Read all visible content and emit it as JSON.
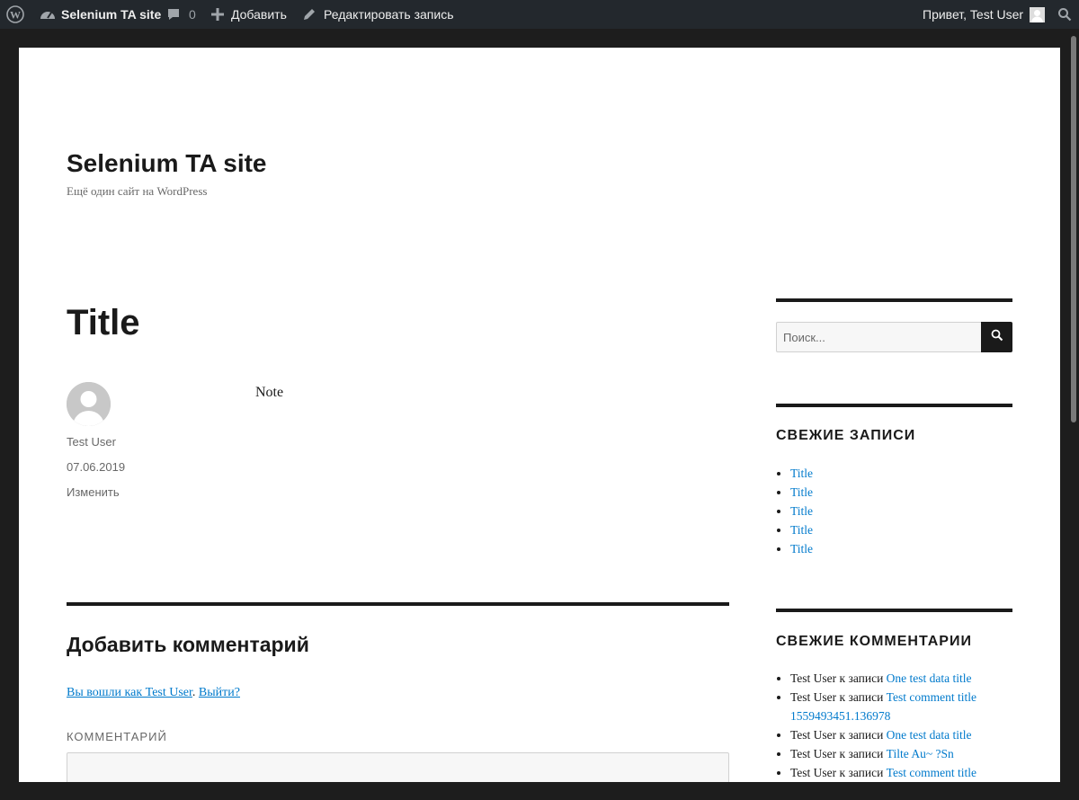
{
  "adminbar": {
    "site_name": "Selenium TA site",
    "comments_count": "0",
    "add_label": "Добавить",
    "edit_label": "Редактировать запись",
    "greeting": "Привет, Test User"
  },
  "site": {
    "title": "Selenium TA site",
    "description": "Ещё один сайт на WordPress"
  },
  "post": {
    "title": "Title",
    "author": "Test User",
    "date": "07.06.2019",
    "edit_label": "Изменить",
    "content": "Note"
  },
  "comments": {
    "reply_title": "Добавить комментарий",
    "logged_in_prefix": "Вы вошли как Test User",
    "logout_link": "Выйти?",
    "comment_label": "КОММЕНТАРИЙ"
  },
  "sidebar": {
    "search_placeholder": "Поиск...",
    "recent_posts_title": "СВЕЖИЕ ЗАПИСИ",
    "recent_posts": [
      "Title",
      "Title",
      "Title",
      "Title",
      "Title"
    ],
    "recent_comments_title": "СВЕЖИЕ КОММЕНТАРИИ",
    "recent_comments": [
      {
        "author": "Test User",
        "connector": " к записи ",
        "post": "One test data title"
      },
      {
        "author": "Test User",
        "connector": " к записи ",
        "post": "Test comment title 1559493451.136978"
      },
      {
        "author": "Test User",
        "connector": " к записи ",
        "post": "One test data title"
      },
      {
        "author": "Test User",
        "connector": " к записи ",
        "post": "Tilte Au~ ?Sn"
      },
      {
        "author": "Test User",
        "connector": " к записи ",
        "post": "Test comment title"
      }
    ]
  }
}
